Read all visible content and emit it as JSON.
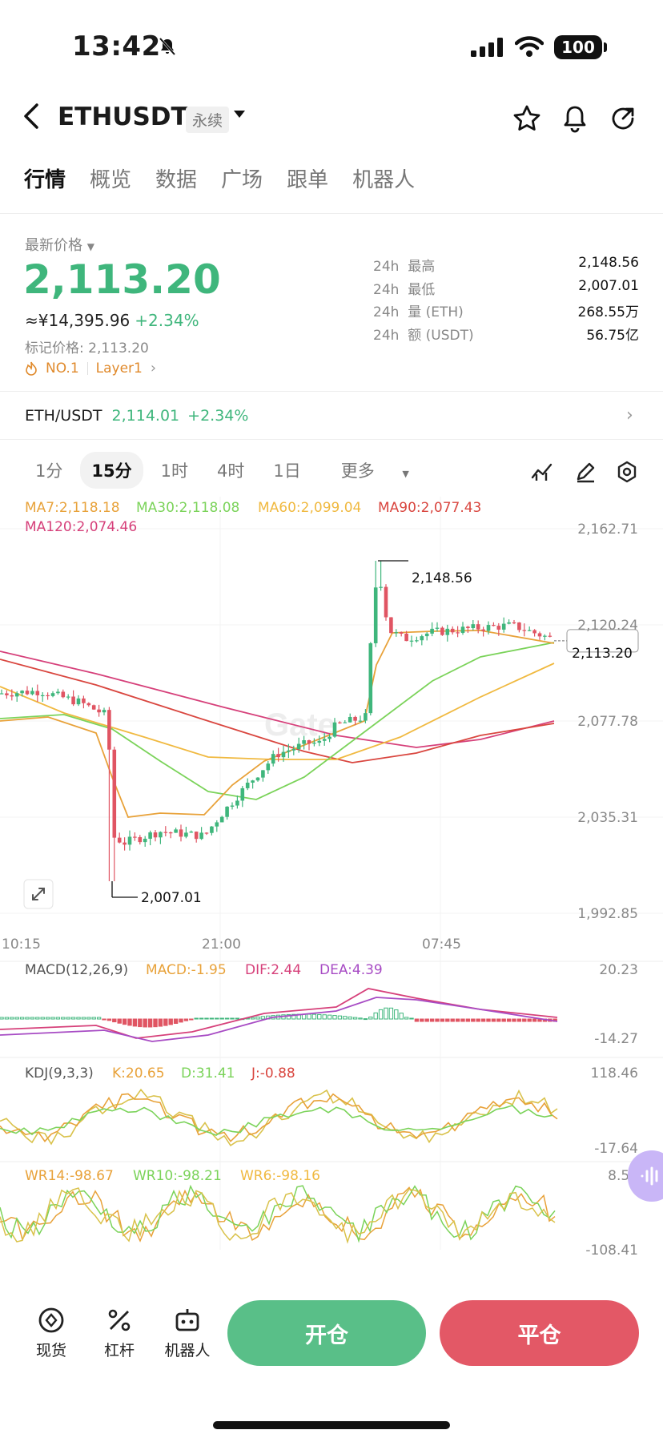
{
  "status_bar": {
    "time": "13:42",
    "battery": "100"
  },
  "header": {
    "pair": "ETHUSDT",
    "contract_type": "永续"
  },
  "tabs": [
    {
      "label": "行情",
      "active": true
    },
    {
      "label": "概览"
    },
    {
      "label": "数据"
    },
    {
      "label": "广场"
    },
    {
      "label": "跟单"
    },
    {
      "label": "机器人"
    }
  ],
  "price_panel": {
    "latest_label": "最新价格",
    "price": "2,113.20",
    "cny": "≈¥14,395.96",
    "change": "+2.34%",
    "mark_price": "标记价格: 2,113.20",
    "tag_rank": "NO.1",
    "tag_sector": "Layer1"
  },
  "stats": [
    {
      "period": "24h",
      "label": "最高",
      "value": "2,148.56"
    },
    {
      "period": "24h",
      "label": "最低",
      "value": "2,007.01"
    },
    {
      "period": "24h",
      "label": "量 (ETH)",
      "value": "268.55万"
    },
    {
      "period": "24h",
      "label": "额 (USDT)",
      "value": "56.75亿"
    }
  ],
  "spot_line": {
    "pair": "ETH/USDT",
    "price": "2,114.01",
    "change": "+2.34%"
  },
  "timeframes": [
    {
      "label": "1分"
    },
    {
      "label": "15分",
      "active": true
    },
    {
      "label": "1时"
    },
    {
      "label": "4时"
    },
    {
      "label": "1日"
    },
    {
      "label": "更多"
    }
  ],
  "ma_legend": {
    "ma7": "MA7:2,118.18",
    "ma30": "MA30:2,118.08",
    "ma60": "MA60:2,099.04",
    "ma90": "MA90:2,077.43",
    "ma120": "MA120:2,074.46"
  },
  "chart_data": {
    "type": "candlestick",
    "price_axis": [
      "2,162.71",
      "2,120.24",
      "2,077.78",
      "2,035.31",
      "1,992.85"
    ],
    "ylim": [
      1992.85,
      2162.71
    ],
    "time_axis": [
      "10:15",
      "21:00",
      "07:45"
    ],
    "high_label": "2,148.56",
    "low_label": "2,007.01",
    "current_price": "2,113.20",
    "high": 2148.56,
    "low": 2007.01,
    "current": 2113.2,
    "colors": {
      "up": "#3fb67c",
      "down": "#e05563",
      "ma7": "#e8a23a",
      "ma30": "#7bd35a",
      "ma60": "#f0b940",
      "ma90": "#d9463f",
      "ma120": "#d6407a",
      "dif": "#d6407a",
      "dea": "#a74bc4",
      "k": "#e8a23a",
      "d": "#7bd35a",
      "j": "#d9c24b"
    }
  },
  "macd": {
    "title": "MACD(12,26,9)",
    "macd": "MACD:-1.95",
    "dif": "DIF:2.44",
    "dea": "DEA:4.39",
    "top": "20.23",
    "bottom": "-14.27"
  },
  "kdj": {
    "title": "KDJ(9,3,3)",
    "k": "K:20.65",
    "d": "D:31.41",
    "j": "J:-0.88",
    "top": "118.46",
    "bottom": "-17.64"
  },
  "wr": {
    "wr14": "WR14:-98.67",
    "wr10": "WR10:-98.21",
    "wr6": "WR6:-98.16",
    "top": "8.57",
    "bottom": "-108.41"
  },
  "bottom_nav": [
    {
      "label": "现货",
      "icon": "spot-icon"
    },
    {
      "label": "杠杆",
      "icon": "leverage-icon"
    },
    {
      "label": "机器人",
      "icon": "robot-icon"
    }
  ],
  "actions": {
    "open": "开仓",
    "close": "平仓"
  }
}
